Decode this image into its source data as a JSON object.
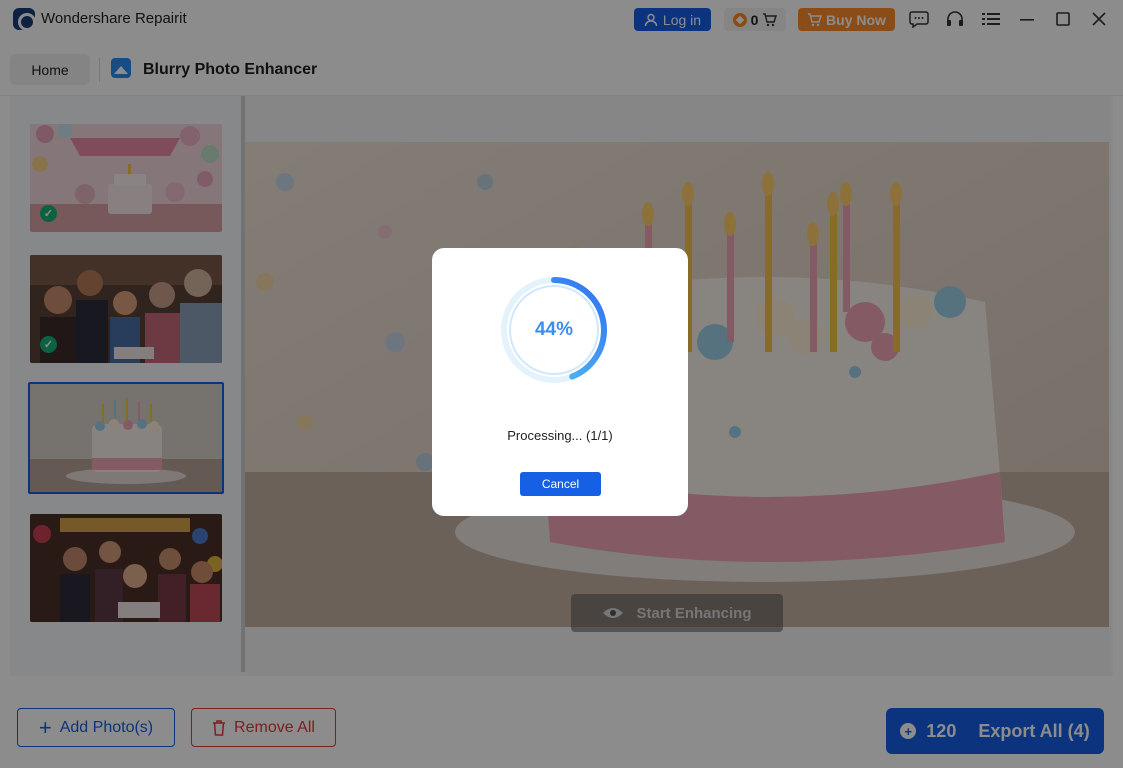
{
  "app": {
    "title": "Wondershare Repairit"
  },
  "titlebar": {
    "login_label": "Log in",
    "credits_value": "0",
    "buy_label": "Buy Now"
  },
  "header": {
    "home_tab": "Home",
    "feature_title": "Blurry Photo Enhancer"
  },
  "preview": {
    "start_label": "Start Enhancing"
  },
  "thumbnails": [
    {
      "name": "birthday-cake-decor",
      "checked": true
    },
    {
      "name": "family-birthday",
      "checked": true
    },
    {
      "name": "cake-candles",
      "checked": false,
      "selected": true
    },
    {
      "name": "kids-party",
      "checked": false
    }
  ],
  "bottom": {
    "add_label": "Add Photo(s)",
    "remove_label": "Remove All",
    "export_credits": "120",
    "export_label": "Export All (4)"
  },
  "dialog": {
    "progress_text": "44%",
    "progress_value": 44,
    "status_text": "Processing... (1/1)",
    "cancel_label": "Cancel"
  },
  "colors": {
    "accent": "#1660e6",
    "buy": "#ff8a2a",
    "danger": "#e23b3b",
    "success": "#15b27b"
  }
}
